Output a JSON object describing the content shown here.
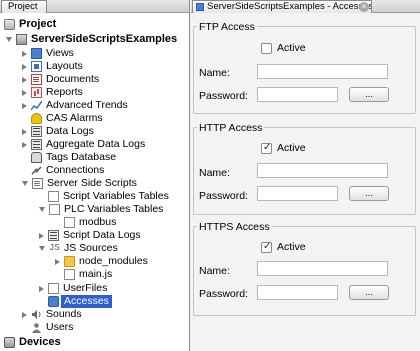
{
  "left_panel": {
    "tab_label": "Project",
    "tree": [
      {
        "label": "Project",
        "icon": "project-icon",
        "name": "tree-project"
      },
      {
        "label": "ServerSideScriptsExamples",
        "icon": "project-node-icon",
        "name": "tree-serversidescriptsexamples"
      },
      {
        "label": "Views",
        "icon": "views-icon",
        "name": "tree-views"
      },
      {
        "label": "Layouts",
        "icon": "layouts-icon",
        "name": "tree-layouts"
      },
      {
        "label": "Documents",
        "icon": "documents-icon",
        "name": "tree-documents"
      },
      {
        "label": "Reports",
        "icon": "reports-icon",
        "name": "tree-reports"
      },
      {
        "label": "Advanced Trends",
        "icon": "trend-icon",
        "name": "tree-advanced-trends"
      },
      {
        "label": "CAS Alarms",
        "icon": "alarm-bell-icon",
        "name": "tree-cas-alarms"
      },
      {
        "label": "Data Logs",
        "icon": "data-logs-icon",
        "name": "tree-data-logs"
      },
      {
        "label": "Aggregate Data Logs",
        "icon": "aggregate-logs-icon",
        "name": "tree-aggregate-data-logs"
      },
      {
        "label": "Tags Database",
        "icon": "database-icon",
        "name": "tree-tags-database"
      },
      {
        "label": "Connections",
        "icon": "connections-icon",
        "name": "tree-connections"
      },
      {
        "label": "Server Side Scripts",
        "icon": "server-scripts-icon",
        "name": "tree-server-side-scripts"
      },
      {
        "label": "Script Variables Tables",
        "icon": "table-icon",
        "name": "tree-script-variables-tables"
      },
      {
        "label": "PLC Variables Tables",
        "icon": "table-icon",
        "name": "tree-plc-variables-tables"
      },
      {
        "label": "modbus",
        "icon": "table-file-icon",
        "name": "tree-modbus"
      },
      {
        "label": "Script Data Logs",
        "icon": "data-logs-icon",
        "name": "tree-script-data-logs"
      },
      {
        "label": "JS Sources",
        "icon": "js-icon",
        "name": "tree-js-sources"
      },
      {
        "label": "node_modules",
        "icon": "folder-icon",
        "name": "tree-node-modules"
      },
      {
        "label": "main.js",
        "icon": "file-icon",
        "name": "tree-main-js"
      },
      {
        "label": "UserFiles",
        "icon": "user-files-icon",
        "name": "tree-userfiles"
      },
      {
        "label": "Accesses",
        "icon": "accesses-icon",
        "name": "tree-accesses"
      },
      {
        "label": "Sounds",
        "icon": "speaker-icon",
        "name": "tree-sounds"
      },
      {
        "label": "Users",
        "icon": "users-icon",
        "name": "tree-users"
      },
      {
        "label": "Devices",
        "icon": "devices-icon",
        "name": "tree-devices"
      }
    ]
  },
  "right_panel": {
    "tab_label": "ServerSideScriptsExamples - Accesses",
    "tab_close": "×",
    "groups": [
      {
        "title": "FTP Access",
        "active_label": "Active",
        "active_checked": false,
        "name_label": "Name:",
        "name_value": "",
        "password_label": "Password:",
        "password_value": "",
        "button_label": "..."
      },
      {
        "title": "HTTP Access",
        "active_label": "Active",
        "active_checked": true,
        "name_label": "Name:",
        "name_value": "",
        "password_label": "Password:",
        "password_value": "",
        "button_label": "..."
      },
      {
        "title": "HTTPS Access",
        "active_label": "Active",
        "active_checked": true,
        "name_label": "Name:",
        "name_value": "",
        "password_label": "Password:",
        "password_value": "",
        "button_label": "..."
      }
    ]
  },
  "colors": {
    "selection": "#2f5fd1",
    "panel_background": "#f3f3f3"
  }
}
